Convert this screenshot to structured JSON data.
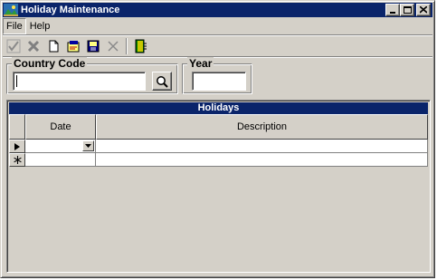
{
  "window": {
    "title": "Holiday Maintenance",
    "app_icon": "holiday-app-icon"
  },
  "menu": {
    "items": [
      {
        "label": "File"
      },
      {
        "label": "Help"
      }
    ]
  },
  "toolbar": {
    "icons": [
      "checkmark-icon",
      "delete-x-icon",
      "new-document-icon",
      "edit-record-icon",
      "save-record-icon",
      "cancel-x-icon",
      "exit-door-icon"
    ]
  },
  "country_code": {
    "label": "Country Code",
    "value": ""
  },
  "year": {
    "label": "Year",
    "value": ""
  },
  "holidays": {
    "caption": "Holidays",
    "columns": [
      "Date",
      "Description"
    ],
    "rows": [
      {
        "indicator": "current-row-arrow-icon",
        "date": "",
        "description": ""
      },
      {
        "indicator": "new-row-asterisk-icon",
        "date": "",
        "description": ""
      }
    ]
  }
}
